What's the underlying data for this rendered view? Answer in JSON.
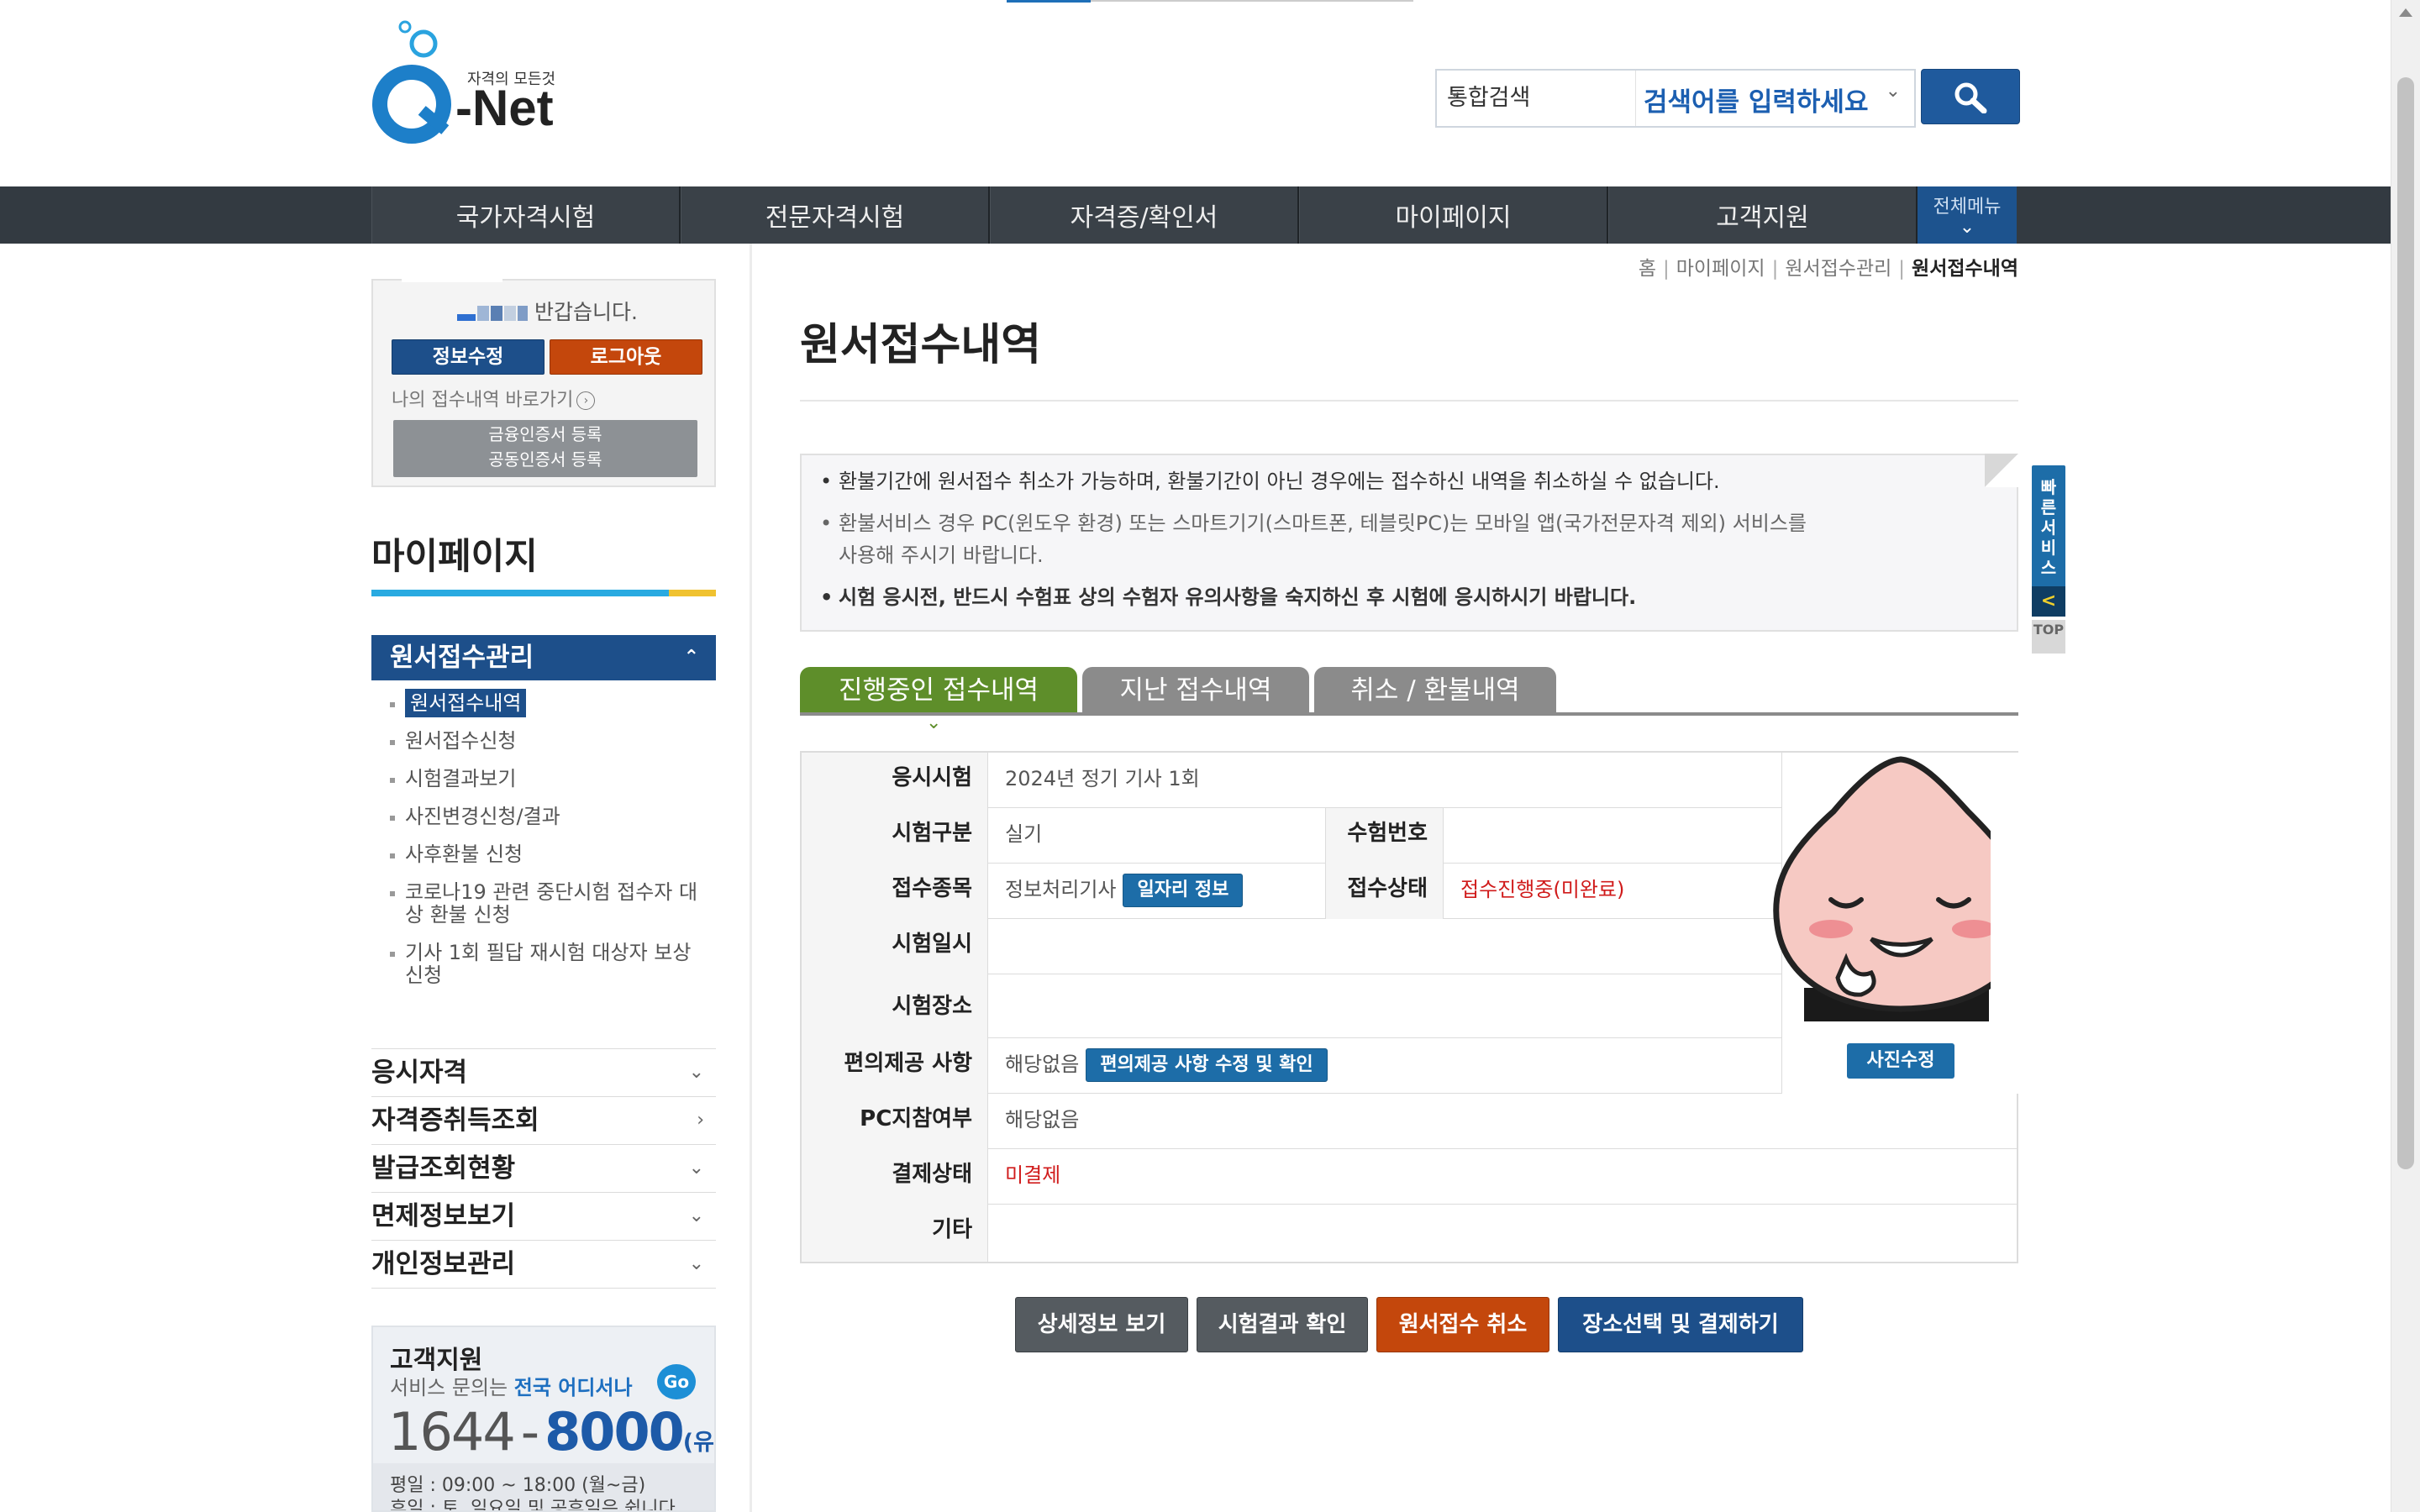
{
  "header": {
    "logo_tagline": "자격의 모든것",
    "logo_text": "-Net",
    "logo_q": "Q",
    "search_scope": "통합검색",
    "search_placeholder": "검색어를 입력하세요"
  },
  "gnb": {
    "items": [
      "국가자격시험",
      "전문자격시험",
      "자격증/확인서",
      "마이페이지",
      "고객지원"
    ],
    "all_menu": "전체메뉴"
  },
  "login": {
    "welcome_suffix": "반갑습니다.",
    "edit_label": "정보수정",
    "logout_label": "로그아웃",
    "shortcut_label": "나의 접수내역 바로가기",
    "cert_line1": "금융인증서 등록",
    "cert_line2": "공동인증서 등록"
  },
  "sidebar": {
    "title": "마이페이지",
    "section": "원서접수관리",
    "subitems": [
      "원서접수내역",
      "원서접수신청",
      "시험결과보기",
      "사진변경신청/결과",
      "사후환불 신청",
      "코로나19 관련 중단시험 접수자 대상 환불 신청",
      "기사 1회 필답 재시험 대상자 보상 신청"
    ],
    "categories": [
      "응시자격",
      "자격증취득조회",
      "발급조회현황",
      "면제정보보기",
      "개인정보관리"
    ]
  },
  "customer": {
    "title": "고객지원",
    "desc_prefix": "서비스 문의는",
    "desc_highlight": "전국 어디서나",
    "go": "Go",
    "phone_a": "1644",
    "phone_dash": "-",
    "phone_b": "8000",
    "phone_note": "(유료)",
    "hours_weekday": "평일 : 09:00 ~ 18:00 (월~금)",
    "hours_holiday": "휴일 : 토, 일요일 및 공휴일은 쉽니다."
  },
  "breadcrumb": [
    "홈",
    "마이페이지",
    "원서접수관리",
    "원서접수내역"
  ],
  "page_title": "원서접수내역",
  "notice": [
    "환불기간에 원서접수 취소가 가능하며, 환불기간이 아닌 경우에는 접수하신 내역을 취소하실 수 없습니다.",
    "환불서비스 경우 PC(윈도우 환경) 또는 스마트기기(스마트폰, 테블릿PC)는 모바일 앱(국가전문자격 제외) 서비스를",
    "사용해 주시기 바랍니다.",
    "시험 응시전, 반드시 수험표 상의 수험자 유의사항을 숙지하신 후 시험에 응시하시기 바랍니다."
  ],
  "tabs": [
    "진행중인 접수내역",
    "지난 접수내역",
    "취소 / 환불내역"
  ],
  "table": {
    "exam_label": "응시시험",
    "exam_value": "2024년 정기 기사 1회",
    "type_label": "시험구분",
    "type_value": "실기",
    "examno_label": "수험번호",
    "examno_value": "",
    "subject_label": "접수종목",
    "subject_value": "정보처리기사",
    "job_btn": "일자리 정보",
    "status_label": "접수상태",
    "status_value": "접수진행중(미완료)",
    "date_label": "시험일시",
    "date_value": "",
    "place_label": "시험장소",
    "place_value": "",
    "conv_label": "편의제공 사항",
    "conv_value": "해당없음",
    "conv_btn": "편의제공 사항 수정 및 확인",
    "pc_label": "PC지참여부",
    "pc_value": "해당없음",
    "pay_label": "결제상태",
    "pay_value": "미결제",
    "etc_label": "기타",
    "etc_value": "",
    "photo_btn": "사진수정"
  },
  "actions": [
    "상세정보 보기",
    "시험결과 확인",
    "원서접수 취소",
    "장소선택 및 결제하기"
  ],
  "quick": {
    "label": "빠른서비스",
    "back": "<",
    "top": "TOP"
  },
  "colors": {
    "brand_blue": "#1d4f8a",
    "accent_orange": "#c4470c",
    "tab_green": "#5e8e2a",
    "status_red": "#d01b1b"
  }
}
